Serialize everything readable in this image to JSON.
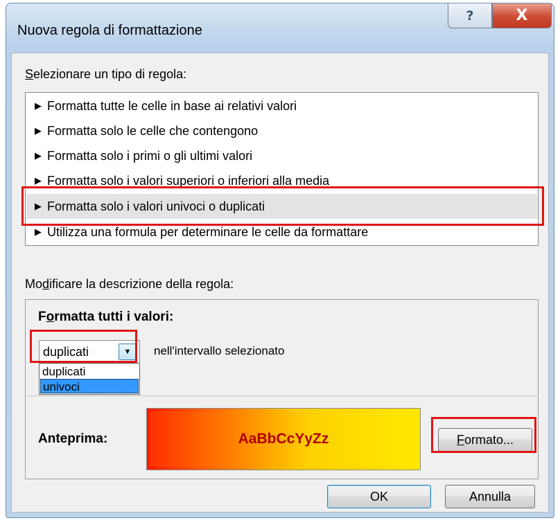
{
  "window": {
    "title": "Nuova regola di formattazione",
    "help_glyph": "?",
    "close_glyph": "X"
  },
  "rule_type": {
    "label_access": "S",
    "label_rest": "elezionare un tipo di regola:",
    "items": [
      {
        "label": "Formatta tutte le celle in base ai relativi valori"
      },
      {
        "label": "Formatta solo le celle che contengono"
      },
      {
        "label": "Formatta solo i primi o gli ultimi valori"
      },
      {
        "label": "Formatta solo i valori superiori o inferiori alla media"
      },
      {
        "label": "Formatta solo i valori univoci o duplicati"
      },
      {
        "label": "Utilizza una formula per determinare le celle da formattare"
      }
    ],
    "selected_index": 4,
    "bullet": "▶"
  },
  "description": {
    "label_pre": "Mo",
    "label_access": "d",
    "label_rest": "ificare la descrizione della regola:",
    "format_all_pre": "F",
    "format_all_access": "o",
    "format_all_rest": "rmatta tutti i valori:",
    "combo_value": "duplicati",
    "combo_arrow": "▼",
    "combo_suffix": "nell'intervallo selezionato",
    "options": [
      "duplicati",
      "univoci"
    ],
    "hovered_option": "univoci",
    "preview_label": "Anteprima:",
    "preview_sample": "AaBbCcYyZz",
    "format_button_access": "F",
    "format_button_rest": "ormato..."
  },
  "buttons": {
    "ok": "OK",
    "cancel": "Annulla"
  },
  "colors": {
    "highlight": "#e01515",
    "selected_row": "#e3e3e3",
    "dropdown_hover": "#3399ff",
    "preview_text": "#b30000"
  }
}
